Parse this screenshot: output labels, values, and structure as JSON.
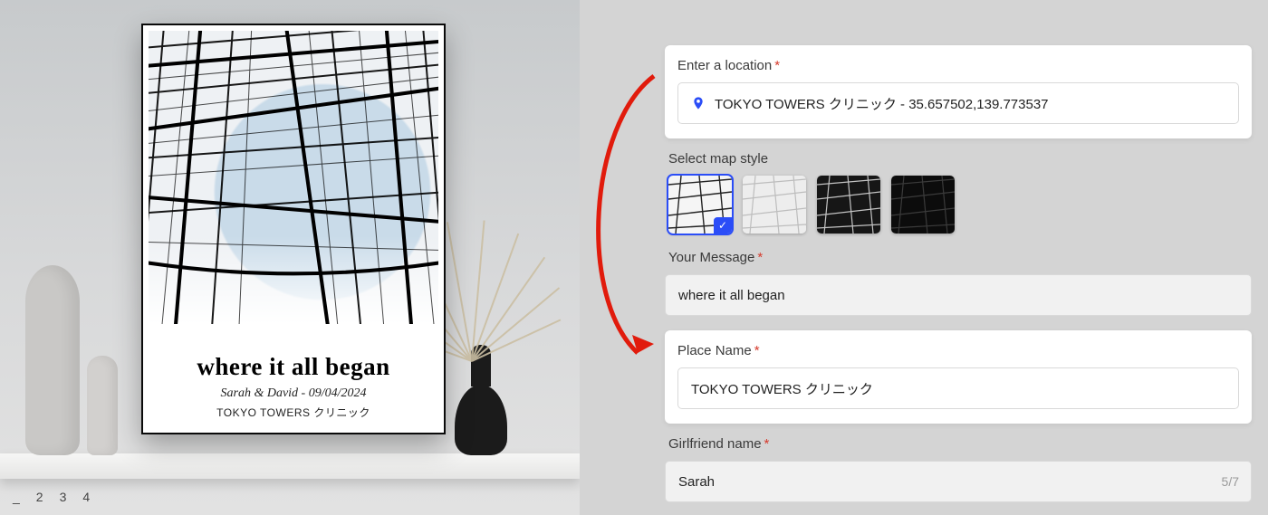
{
  "preview": {
    "title": "where it all began",
    "subline": "Sarah  & David  -  09/04/2024",
    "place": "TOKYO TOWERS クリニック"
  },
  "pager": {
    "items": [
      "_",
      "2",
      "3",
      "4"
    ]
  },
  "form": {
    "location": {
      "label": "Enter a location",
      "value": "TOKYO TOWERS クリニック - 35.657502,139.773537"
    },
    "map_style": {
      "label": "Select map style",
      "options": [
        "light-roads",
        "light-grey",
        "dark-roads",
        "black"
      ],
      "selected_index": 0
    },
    "message": {
      "label": "Your Message",
      "value": "where it all began"
    },
    "place_name": {
      "label": "Place Name",
      "value": "TOKYO TOWERS クリニック"
    },
    "girlfriend": {
      "label": "Girlfriend name",
      "value": "Sarah",
      "char_count": "5/7"
    }
  },
  "colors": {
    "accent": "#2b4df7",
    "required": "#d63a2c",
    "arrow": "#e11b0c"
  }
}
